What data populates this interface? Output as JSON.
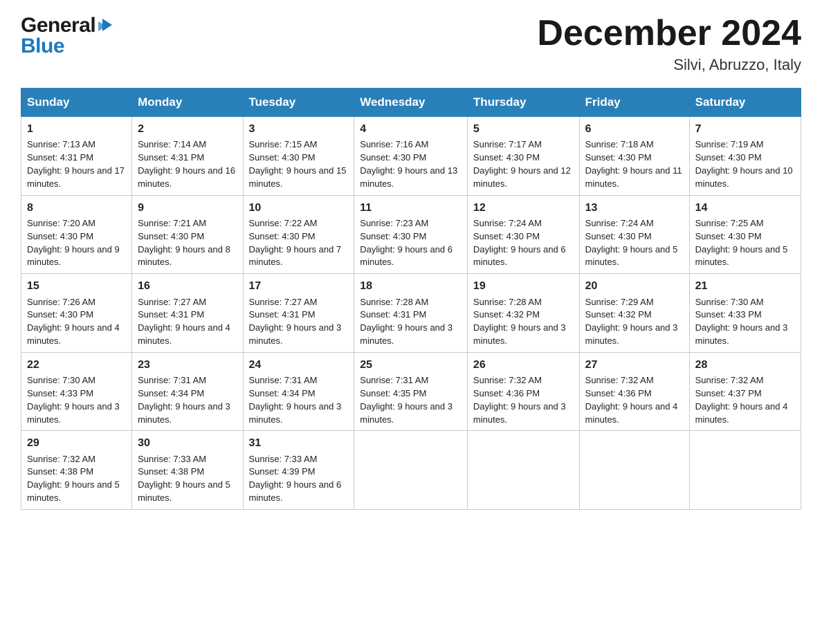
{
  "header": {
    "logo_general": "General",
    "logo_blue": "Blue",
    "month_title": "December 2024",
    "location": "Silvi, Abruzzo, Italy"
  },
  "days_of_week": [
    "Sunday",
    "Monday",
    "Tuesday",
    "Wednesday",
    "Thursday",
    "Friday",
    "Saturday"
  ],
  "weeks": [
    [
      {
        "day": "1",
        "sunrise": "Sunrise: 7:13 AM",
        "sunset": "Sunset: 4:31 PM",
        "daylight": "Daylight: 9 hours and 17 minutes."
      },
      {
        "day": "2",
        "sunrise": "Sunrise: 7:14 AM",
        "sunset": "Sunset: 4:31 PM",
        "daylight": "Daylight: 9 hours and 16 minutes."
      },
      {
        "day": "3",
        "sunrise": "Sunrise: 7:15 AM",
        "sunset": "Sunset: 4:30 PM",
        "daylight": "Daylight: 9 hours and 15 minutes."
      },
      {
        "day": "4",
        "sunrise": "Sunrise: 7:16 AM",
        "sunset": "Sunset: 4:30 PM",
        "daylight": "Daylight: 9 hours and 13 minutes."
      },
      {
        "day": "5",
        "sunrise": "Sunrise: 7:17 AM",
        "sunset": "Sunset: 4:30 PM",
        "daylight": "Daylight: 9 hours and 12 minutes."
      },
      {
        "day": "6",
        "sunrise": "Sunrise: 7:18 AM",
        "sunset": "Sunset: 4:30 PM",
        "daylight": "Daylight: 9 hours and 11 minutes."
      },
      {
        "day": "7",
        "sunrise": "Sunrise: 7:19 AM",
        "sunset": "Sunset: 4:30 PM",
        "daylight": "Daylight: 9 hours and 10 minutes."
      }
    ],
    [
      {
        "day": "8",
        "sunrise": "Sunrise: 7:20 AM",
        "sunset": "Sunset: 4:30 PM",
        "daylight": "Daylight: 9 hours and 9 minutes."
      },
      {
        "day": "9",
        "sunrise": "Sunrise: 7:21 AM",
        "sunset": "Sunset: 4:30 PM",
        "daylight": "Daylight: 9 hours and 8 minutes."
      },
      {
        "day": "10",
        "sunrise": "Sunrise: 7:22 AM",
        "sunset": "Sunset: 4:30 PM",
        "daylight": "Daylight: 9 hours and 7 minutes."
      },
      {
        "day": "11",
        "sunrise": "Sunrise: 7:23 AM",
        "sunset": "Sunset: 4:30 PM",
        "daylight": "Daylight: 9 hours and 6 minutes."
      },
      {
        "day": "12",
        "sunrise": "Sunrise: 7:24 AM",
        "sunset": "Sunset: 4:30 PM",
        "daylight": "Daylight: 9 hours and 6 minutes."
      },
      {
        "day": "13",
        "sunrise": "Sunrise: 7:24 AM",
        "sunset": "Sunset: 4:30 PM",
        "daylight": "Daylight: 9 hours and 5 minutes."
      },
      {
        "day": "14",
        "sunrise": "Sunrise: 7:25 AM",
        "sunset": "Sunset: 4:30 PM",
        "daylight": "Daylight: 9 hours and 5 minutes."
      }
    ],
    [
      {
        "day": "15",
        "sunrise": "Sunrise: 7:26 AM",
        "sunset": "Sunset: 4:30 PM",
        "daylight": "Daylight: 9 hours and 4 minutes."
      },
      {
        "day": "16",
        "sunrise": "Sunrise: 7:27 AM",
        "sunset": "Sunset: 4:31 PM",
        "daylight": "Daylight: 9 hours and 4 minutes."
      },
      {
        "day": "17",
        "sunrise": "Sunrise: 7:27 AM",
        "sunset": "Sunset: 4:31 PM",
        "daylight": "Daylight: 9 hours and 3 minutes."
      },
      {
        "day": "18",
        "sunrise": "Sunrise: 7:28 AM",
        "sunset": "Sunset: 4:31 PM",
        "daylight": "Daylight: 9 hours and 3 minutes."
      },
      {
        "day": "19",
        "sunrise": "Sunrise: 7:28 AM",
        "sunset": "Sunset: 4:32 PM",
        "daylight": "Daylight: 9 hours and 3 minutes."
      },
      {
        "day": "20",
        "sunrise": "Sunrise: 7:29 AM",
        "sunset": "Sunset: 4:32 PM",
        "daylight": "Daylight: 9 hours and 3 minutes."
      },
      {
        "day": "21",
        "sunrise": "Sunrise: 7:30 AM",
        "sunset": "Sunset: 4:33 PM",
        "daylight": "Daylight: 9 hours and 3 minutes."
      }
    ],
    [
      {
        "day": "22",
        "sunrise": "Sunrise: 7:30 AM",
        "sunset": "Sunset: 4:33 PM",
        "daylight": "Daylight: 9 hours and 3 minutes."
      },
      {
        "day": "23",
        "sunrise": "Sunrise: 7:31 AM",
        "sunset": "Sunset: 4:34 PM",
        "daylight": "Daylight: 9 hours and 3 minutes."
      },
      {
        "day": "24",
        "sunrise": "Sunrise: 7:31 AM",
        "sunset": "Sunset: 4:34 PM",
        "daylight": "Daylight: 9 hours and 3 minutes."
      },
      {
        "day": "25",
        "sunrise": "Sunrise: 7:31 AM",
        "sunset": "Sunset: 4:35 PM",
        "daylight": "Daylight: 9 hours and 3 minutes."
      },
      {
        "day": "26",
        "sunrise": "Sunrise: 7:32 AM",
        "sunset": "Sunset: 4:36 PM",
        "daylight": "Daylight: 9 hours and 3 minutes."
      },
      {
        "day": "27",
        "sunrise": "Sunrise: 7:32 AM",
        "sunset": "Sunset: 4:36 PM",
        "daylight": "Daylight: 9 hours and 4 minutes."
      },
      {
        "day": "28",
        "sunrise": "Sunrise: 7:32 AM",
        "sunset": "Sunset: 4:37 PM",
        "daylight": "Daylight: 9 hours and 4 minutes."
      }
    ],
    [
      {
        "day": "29",
        "sunrise": "Sunrise: 7:32 AM",
        "sunset": "Sunset: 4:38 PM",
        "daylight": "Daylight: 9 hours and 5 minutes."
      },
      {
        "day": "30",
        "sunrise": "Sunrise: 7:33 AM",
        "sunset": "Sunset: 4:38 PM",
        "daylight": "Daylight: 9 hours and 5 minutes."
      },
      {
        "day": "31",
        "sunrise": "Sunrise: 7:33 AM",
        "sunset": "Sunset: 4:39 PM",
        "daylight": "Daylight: 9 hours and 6 minutes."
      },
      null,
      null,
      null,
      null
    ]
  ]
}
